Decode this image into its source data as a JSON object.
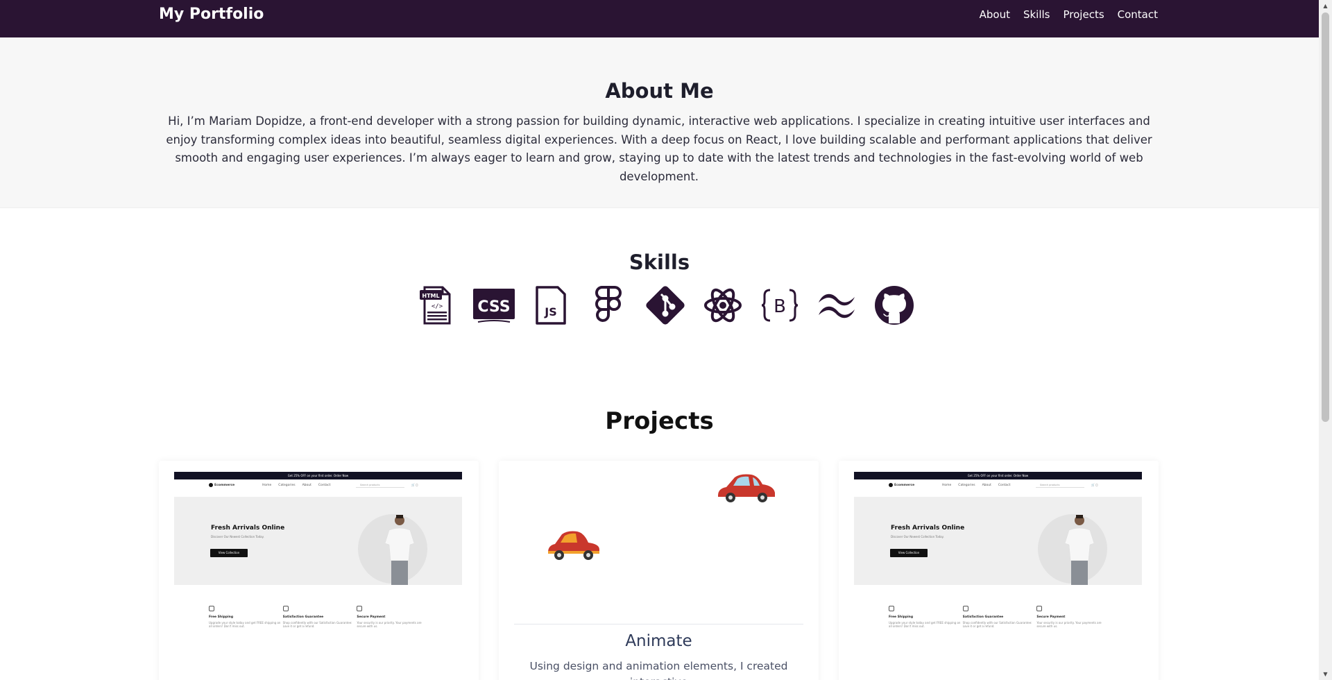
{
  "navbar": {
    "brand": "My Portfolio",
    "links": [
      "About",
      "Skills",
      "Projects",
      "Contact"
    ]
  },
  "about": {
    "title": "About Me",
    "text": "Hi, I’m Mariam Dopidze, a front-end developer with a strong passion for building dynamic, interactive web applications. I specialize in creating intuitive user interfaces and enjoy transforming complex ideas into beautiful, seamless digital experiences. With a deep focus on React, I love building scalable and performant applications that deliver smooth and engaging user experiences. I’m always eager to learn and grow, staying up to date with the latest trends and technologies in the fast-evolving world of web development."
  },
  "skills": {
    "title": "Skills",
    "icons": [
      "html-icon",
      "css-icon",
      "javascript-icon",
      "figma-icon",
      "git-icon",
      "react-icon",
      "bootstrap-icon",
      "tailwind-icon",
      "github-icon"
    ],
    "icon_color": "#2a1433"
  },
  "projects": {
    "title": "Projects",
    "cards": [
      {
        "preview": {
          "banner": "Get 25% OFF on your first order. Order Now",
          "logo": "Ecommerce",
          "menu": [
            "Home",
            "Categories",
            "About",
            "Contact"
          ],
          "search_placeholder": "Search products",
          "hero_title": "Fresh Arrivals Online",
          "hero_subtitle": "Discover Our Newest Collection Today.",
          "hero_button": "View Collection",
          "features": [
            {
              "title": "Free Shipping",
              "text": "Upgrade your style today and get FREE shipping on all orders! Don't miss out."
            },
            {
              "title": "Satisfaction Guarantee",
              "text": "Shop confidently with our Satisfaction Guarantee: Love it or get a refund."
            },
            {
              "title": "Secure Payment",
              "text": "Your security is our priority. Your payments are secure with us."
            }
          ]
        }
      },
      {
        "title": "Animate",
        "description": "Using design and animation elements, I created interactive"
      },
      {
        "preview": {
          "banner": "Get 25% OFF on your first order. Order Now",
          "logo": "Ecommerce",
          "menu": [
            "Home",
            "Categories",
            "About",
            "Contact"
          ],
          "search_placeholder": "Search products",
          "hero_title": "Fresh Arrivals Online",
          "hero_subtitle": "Discover Our Newest Collection Today.",
          "hero_button": "View Collection",
          "features": [
            {
              "title": "Free Shipping",
              "text": "Upgrade your style today and get FREE shipping on all orders! Don't miss out."
            },
            {
              "title": "Satisfaction Guarantee",
              "text": "Shop confidently with our Satisfaction Guarantee: Love it or get a refund."
            },
            {
              "title": "Secure Payment",
              "text": "Your security is our priority. Your payments are secure with us."
            }
          ]
        }
      }
    ]
  },
  "colors": {
    "navbar_bg": "#2a1433",
    "about_bg": "#f7f7f7",
    "car": "#c9372c"
  }
}
